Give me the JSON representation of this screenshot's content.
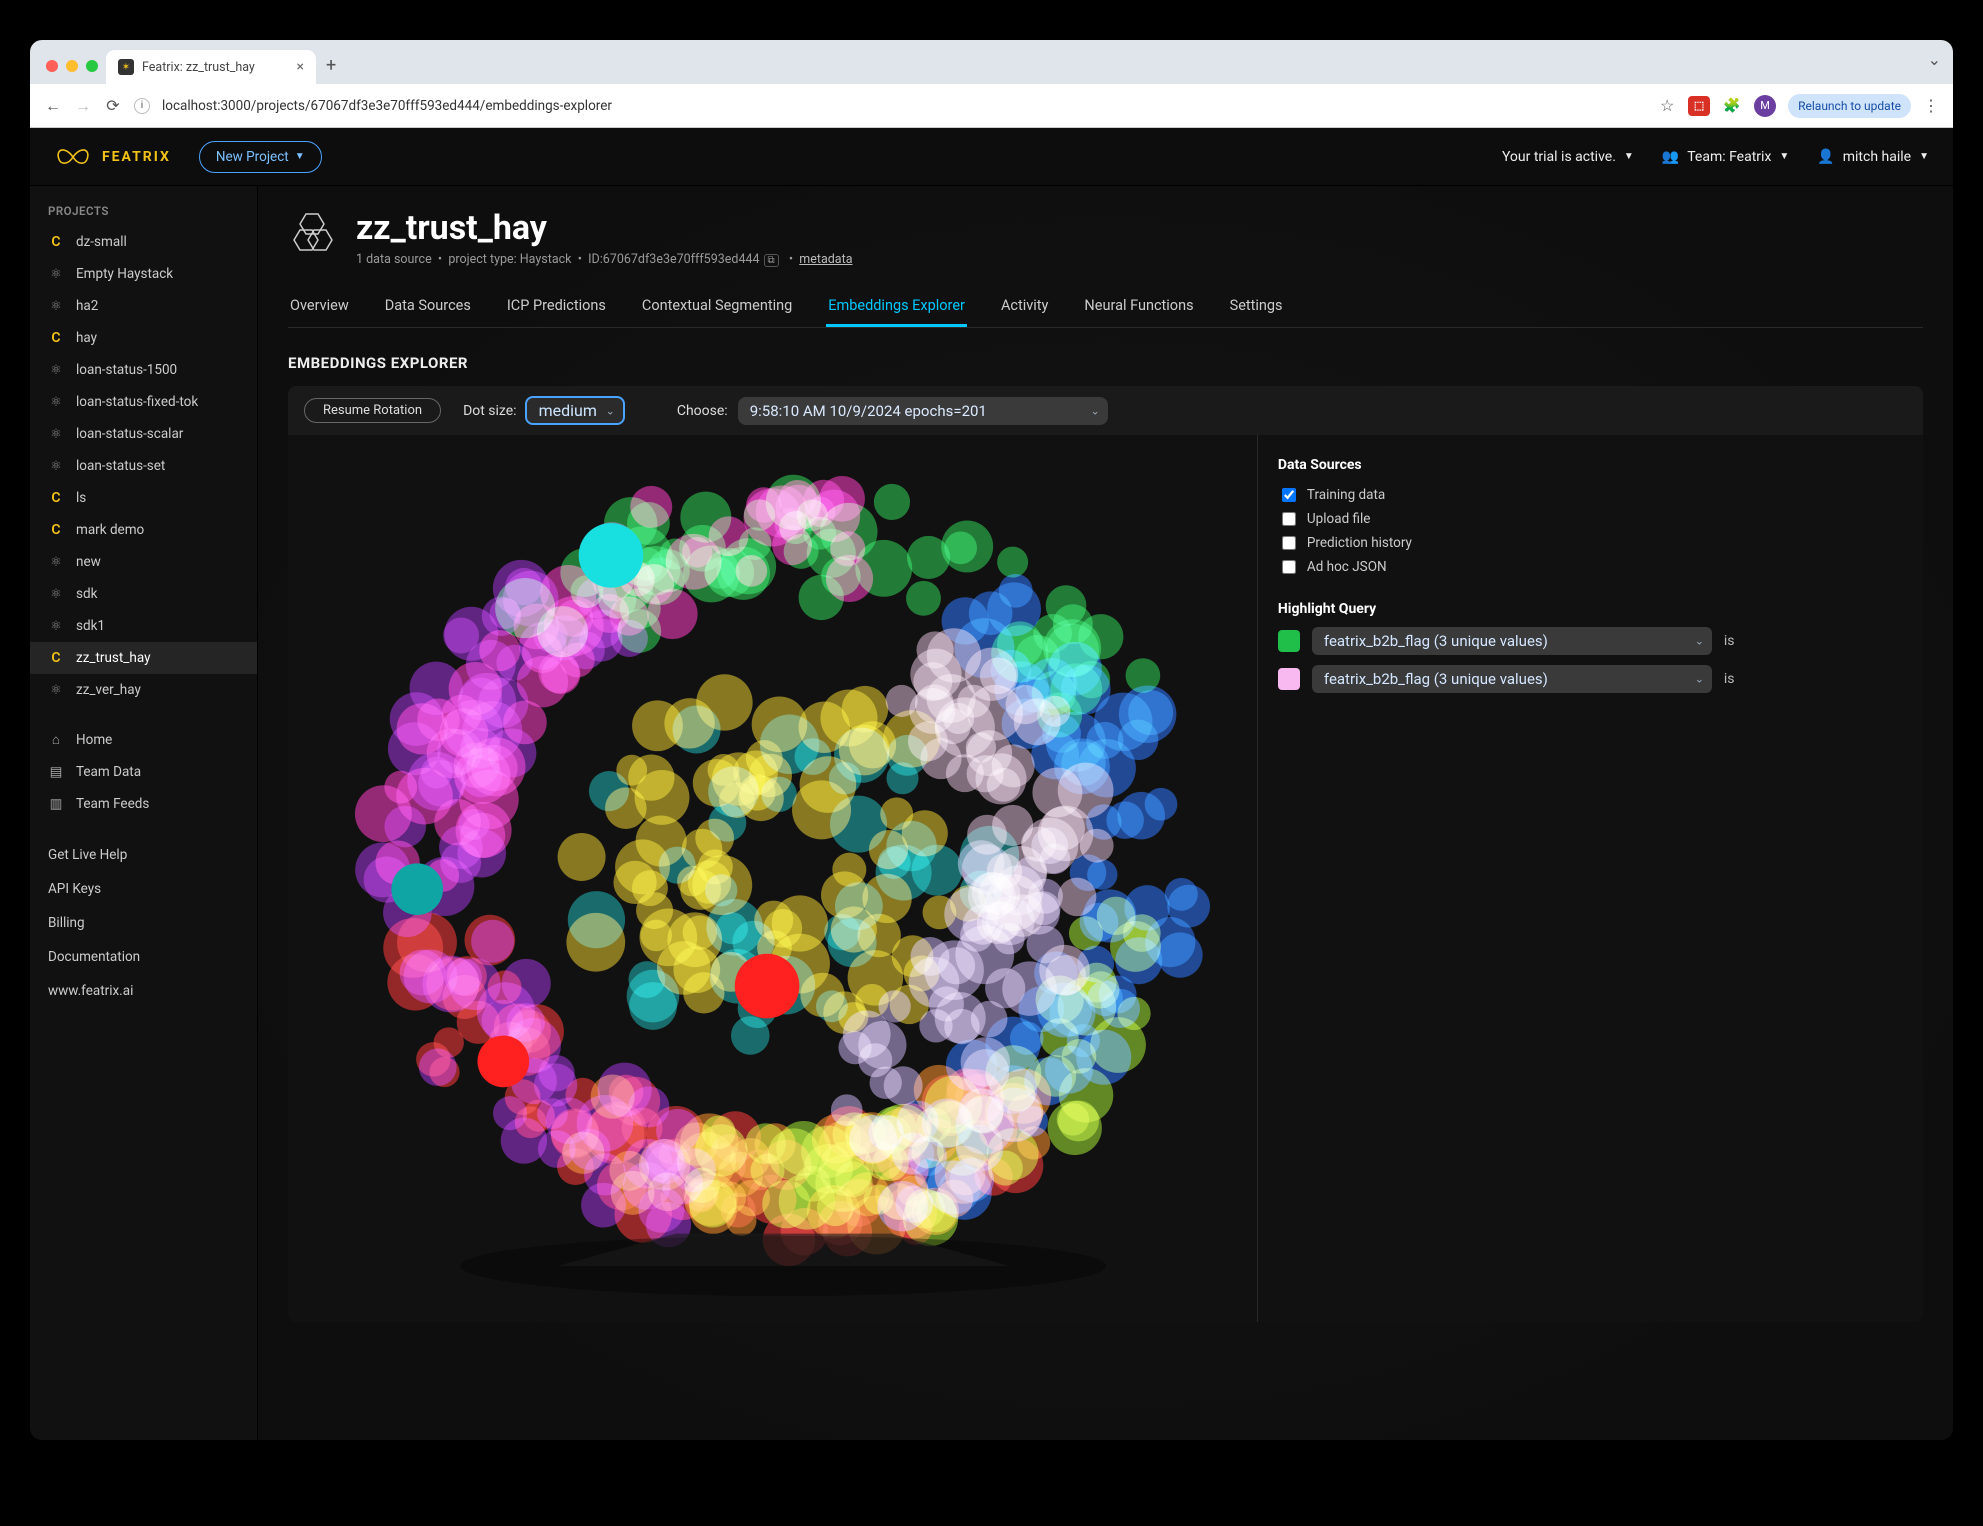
{
  "browser": {
    "tab_title": "Featrix: zz_trust_hay",
    "url": "localhost:3000/projects/67067df3e3e70fff593ed444/embeddings-explorer",
    "relaunch": "Relaunch to update",
    "avatar_letter": "M"
  },
  "topbar": {
    "brand": "FEATRIX",
    "new_project": "New Project",
    "trial": "Your trial is active.",
    "team": "Team: Featrix",
    "user": "mitch haile"
  },
  "sidebar": {
    "heading": "PROJECTS",
    "projects": [
      {
        "icon": "c",
        "label": "dz-small"
      },
      {
        "icon": "atom",
        "label": "Empty Haystack"
      },
      {
        "icon": "atom",
        "label": "ha2"
      },
      {
        "icon": "c",
        "label": "hay"
      },
      {
        "icon": "atom",
        "label": "loan-status-1500"
      },
      {
        "icon": "atom",
        "label": "loan-status-fixed-tok"
      },
      {
        "icon": "atom",
        "label": "loan-status-scalar"
      },
      {
        "icon": "atom",
        "label": "loan-status-set"
      },
      {
        "icon": "c",
        "label": "ls"
      },
      {
        "icon": "c",
        "label": "mark demo"
      },
      {
        "icon": "atom",
        "label": "new"
      },
      {
        "icon": "atom",
        "label": "sdk"
      },
      {
        "icon": "atom",
        "label": "sdk1"
      },
      {
        "icon": "c",
        "label": "zz_trust_hay",
        "selected": true
      },
      {
        "icon": "atom",
        "label": "zz_ver_hay"
      }
    ],
    "nav": [
      {
        "icon": "home",
        "label": "Home"
      },
      {
        "icon": "db",
        "label": "Team Data"
      },
      {
        "icon": "feed",
        "label": "Team Feeds"
      }
    ],
    "links": [
      "Get Live Help",
      "API Keys",
      "Billing",
      "Documentation",
      "www.featrix.ai"
    ]
  },
  "page": {
    "title": "zz_trust_hay",
    "meta_sources": "1 data source",
    "meta_type": "project type: Haystack",
    "meta_id": "ID:67067df3e3e70fff593ed444",
    "meta_link": "metadata"
  },
  "tabs": [
    "Overview",
    "Data Sources",
    "ICP Predictions",
    "Contextual Segmenting",
    "Embeddings Explorer",
    "Activity",
    "Neural Functions",
    "Settings"
  ],
  "active_tab": "Embeddings Explorer",
  "explorer": {
    "title": "EMBEDDINGS EXPLORER",
    "resume": "Resume Rotation",
    "dot_label": "Dot size:",
    "dot_value": "medium",
    "choose_label": "Choose:",
    "choose_value": "9:58:10 AM 10/9/2024 epochs=201",
    "ds_head": "Data Sources",
    "ds_items": [
      {
        "label": "Training data",
        "checked": true
      },
      {
        "label": "Upload file",
        "checked": false
      },
      {
        "label": "Prediction history",
        "checked": false
      },
      {
        "label": "Ad hoc JSON",
        "checked": false
      }
    ],
    "hq_head": "Highlight Query",
    "hq_value": "featrix_b2b_flag (3 unique values)",
    "is": "is"
  },
  "colors": {
    "clusters": [
      "#21d14b",
      "#1f6eff",
      "#9fe627",
      "#ff2d2d",
      "#ff8a1f",
      "#9b27d8",
      "#ff2fc5",
      "#e6c81f",
      "#12b1b1",
      "#d7b4cf",
      "#bda8e8"
    ]
  }
}
